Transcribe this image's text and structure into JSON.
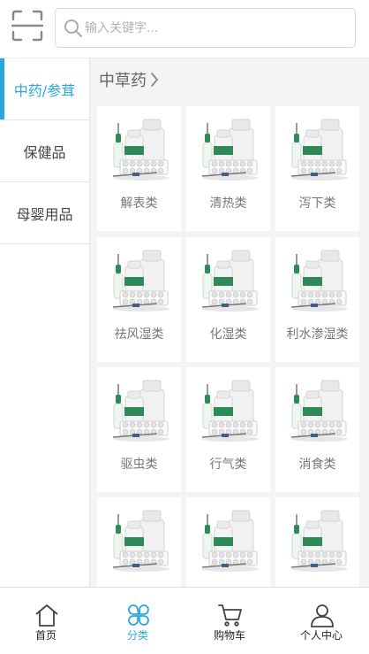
{
  "header": {
    "scan_icon": "scan-icon",
    "search_icon": "search-icon",
    "search_placeholder": "输入关键字...",
    "search_value": ""
  },
  "sidebar": {
    "items": [
      {
        "label": "中药/参茸",
        "active": true
      },
      {
        "label": "保健品",
        "active": false
      },
      {
        "label": "母婴用品",
        "active": false
      }
    ]
  },
  "content": {
    "category_title": "中草药",
    "items": [
      {
        "name": "解表类"
      },
      {
        "name": "清热类"
      },
      {
        "name": "泻下类"
      },
      {
        "name": "祛风湿类"
      },
      {
        "name": "化湿类"
      },
      {
        "name": "利水渗湿类"
      },
      {
        "name": "驱虫类"
      },
      {
        "name": "行气类"
      },
      {
        "name": "消食类"
      },
      {
        "name": ""
      },
      {
        "name": ""
      },
      {
        "name": ""
      }
    ]
  },
  "tabbar": {
    "tabs": [
      {
        "label": "首页",
        "icon": "home-icon",
        "active": false
      },
      {
        "label": "分类",
        "icon": "category-icon",
        "active": true
      },
      {
        "label": "购物车",
        "icon": "cart-icon",
        "active": false
      },
      {
        "label": "个人中心",
        "icon": "user-icon",
        "active": false
      }
    ]
  },
  "colors": {
    "accent": "#2ba7e0",
    "content_bg": "#f4f4f4"
  }
}
